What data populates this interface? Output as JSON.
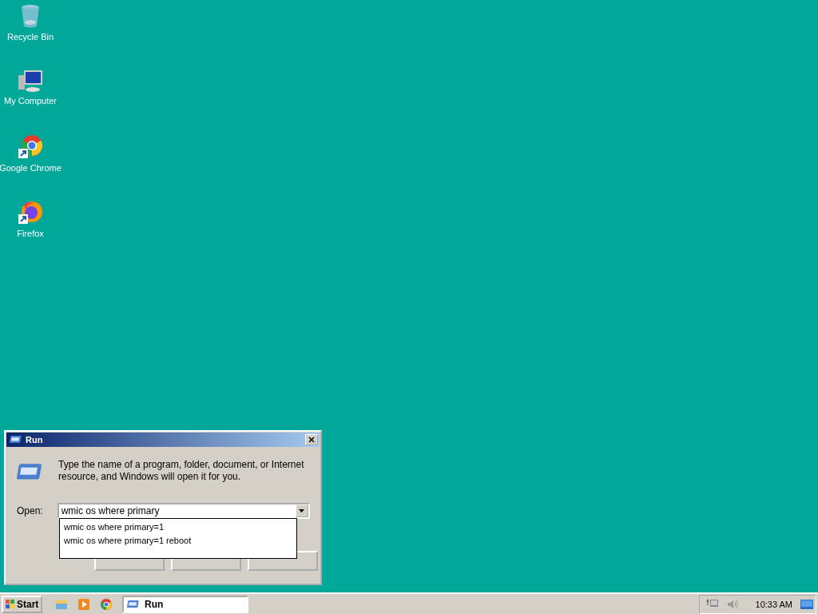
{
  "desktop_icons": [
    {
      "kind": "recycle",
      "label": "Recycle Bin"
    },
    {
      "kind": "computer",
      "label": "My Computer"
    },
    {
      "kind": "chrome",
      "label": "Google Chrome"
    },
    {
      "kind": "firefox",
      "label": "Firefox"
    }
  ],
  "dialog": {
    "title": "Run",
    "message": "Type the name of a program, folder, document, or Internet resource, and Windows will open it for you.",
    "open_label": "Open:",
    "open_value": "wmic os where primary",
    "suggestions": [
      "wmic os where primary=1",
      "wmic os where primary=1 reboot"
    ],
    "buttons": [
      {
        "kind": "push"
      },
      {
        "kind": "push"
      },
      {
        "kind": "push"
      }
    ]
  },
  "taskbar": {
    "start": "Start",
    "quick_launch": [
      {
        "kind": "explorer"
      },
      {
        "kind": "media"
      },
      {
        "kind": "chrome"
      }
    ],
    "tasks": [
      {
        "label": "Run",
        "selected": true
      }
    ],
    "clock": "10:33 AM"
  }
}
